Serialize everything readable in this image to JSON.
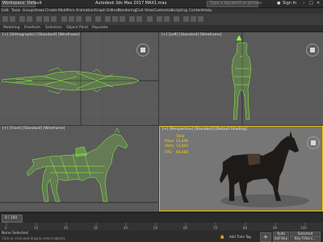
{
  "window": {
    "workspace": "Workspace: Default",
    "title": "Autodesk 3ds Max 2017     MAX1.max",
    "search_placeholder": "Type a keyword or phrase",
    "user": "Sign In"
  },
  "menu": [
    "Edit",
    "Tools",
    "Group",
    "Views",
    "Create",
    "Modifiers",
    "Animation",
    "Graph Editors",
    "Rendering",
    "Civil View",
    "Customize",
    "Scripting",
    "Content",
    "Help"
  ],
  "ribbon": [
    "Modeling",
    "Freeform",
    "Selection",
    "Object Paint",
    "Populate"
  ],
  "viewports": {
    "top_left": "[+] [Orthographic] [Standard] [Wireframe]",
    "top_right": "[+] [Left] [Standard] [Wireframe]",
    "bottom_left": "[+] [Front] [Standard] [Wireframe]",
    "bottom_right": "[+] [Perspective] [Standard] [Default Shading]"
  },
  "stats": {
    "total_label": "Total",
    "polys_label": "Polys",
    "polys_value": "22,446",
    "verts_label": "Verts",
    "verts_value": "12,843",
    "fps_label": "FPS:",
    "fps_value": "66.080"
  },
  "timeline": {
    "frame_counter": "0 / 100",
    "ticks": [
      "0",
      "10",
      "20",
      "30",
      "40",
      "50",
      "60",
      "70",
      "80",
      "90",
      "100"
    ]
  },
  "status": {
    "selection": "None Selected",
    "prompt": "Click or click-and-drag to select objects",
    "time_tag": "Add Time Tag",
    "auto_key": "Auto Key",
    "set_key": "Set Key",
    "key_filter": "Selected",
    "filters": "Key Filters..."
  },
  "colors": {
    "wire": "#8cff3a",
    "active_border": "#e8c200",
    "stats_text": "#ffd200"
  }
}
